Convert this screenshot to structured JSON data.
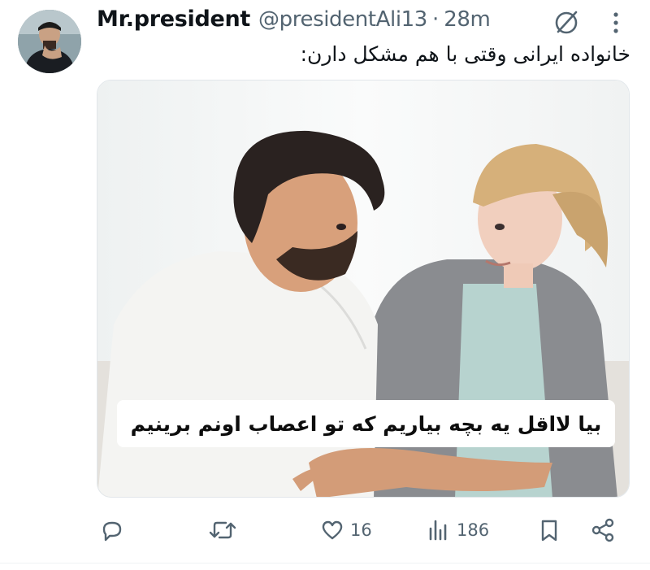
{
  "tweet": {
    "display_name": "Mr.president",
    "handle": "@presidentAli13",
    "separator": "·",
    "time": "28m",
    "text": "خانواده ایرانی وقتی با هم مشکل دارن:",
    "image_caption": "بیا لااقل یه بچه بیاریم که تو اعصاب اونم برینیم"
  },
  "actions": {
    "reply_count": "",
    "retweet_count": "",
    "like_count": "16",
    "views_count": "186"
  },
  "icons": {
    "grok": "grok-icon",
    "more": "more-vertical-icon",
    "reply": "reply-icon",
    "retweet": "retweet-icon",
    "like": "heart-icon",
    "views": "views-icon",
    "bookmark": "bookmark-icon",
    "share": "share-icon"
  },
  "colors": {
    "text": "#0f1419",
    "secondary": "#536471"
  }
}
